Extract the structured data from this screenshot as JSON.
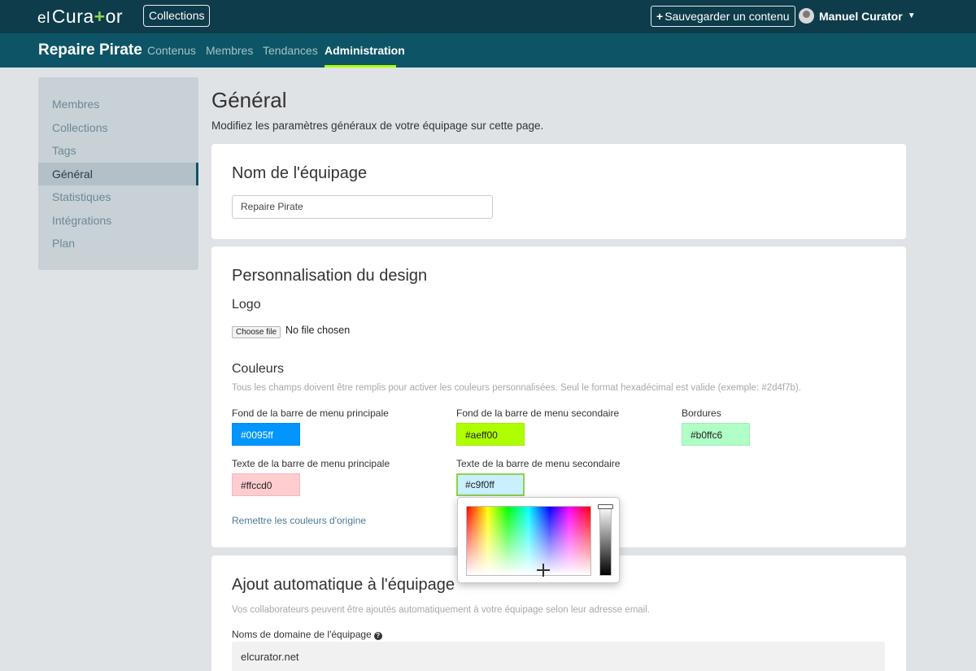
{
  "topbar": {
    "logo_prefix": "el",
    "logo_main_start": "Cura",
    "logo_plus": "+",
    "logo_main_end": "or",
    "collections_label": "Collections",
    "save_label": "Sauvegarder un contenu",
    "user_name": "Manuel Curator"
  },
  "navbar": {
    "team_name": "Repaire Pirate",
    "items": [
      "Contenus",
      "Membres",
      "Tendances",
      "Administration"
    ],
    "active": "Administration",
    "accent_color": "#aeff00"
  },
  "sidebar": {
    "items": [
      "Membres",
      "Collections",
      "Tags",
      "Général",
      "Statistiques",
      "Intégrations",
      "Plan"
    ],
    "active": "Général"
  },
  "page": {
    "title": "Général",
    "subtitle": "Modifiez les paramètres généraux de votre équipage sur cette page."
  },
  "team_name_section": {
    "title": "Nom de l'équipage",
    "value": "Repaire Pirate"
  },
  "design_section": {
    "title": "Personnalisation du design",
    "logo_title": "Logo",
    "file_button": "Choose file",
    "file_status": "No file chosen",
    "colors_title": "Couleurs",
    "colors_help": "Tous les champs doivent être remplis pour activer les couleurs personnalisées. Seul le format hexadécimal est valide (exemple: #2d4f7b).",
    "fields": [
      {
        "label": "Fond de la barre de menu principale",
        "value": "#0095ff",
        "color": "#0095ff",
        "text_color": "#ffffff"
      },
      {
        "label": "Fond de la barre de menu secondaire",
        "value": "#aeff00",
        "color": "#aeff00",
        "text_color": "#222222"
      },
      {
        "label": "Bordures",
        "value": "#b0ffc6",
        "color": "#b0ffc6",
        "text_color": "#222222"
      },
      {
        "label": "Texte de la barre de menu principale",
        "value": "#ffccd0",
        "color": "#ffccd0",
        "text_color": "#222222"
      },
      {
        "label": "Texte de la barre de menu secondaire",
        "value": "#c9f0ff",
        "color": "#c9f0ff",
        "text_color": "#222222"
      }
    ],
    "reset_link": "Remettre les couleurs d'origine"
  },
  "auto_add_section": {
    "title": "Ajout automatique à l'équipage",
    "help": "Vos collaborateurs peuvent être ajoutés automatiquement à votre équipage selon leur adresse email.",
    "domain_label": "Noms de domaine de l'équipage",
    "domain_value": "elcurator.net"
  },
  "icons": {
    "plus": "plus-icon",
    "caret": "caret-down-icon",
    "help": "question-circle-icon",
    "avatar": "user-avatar"
  }
}
